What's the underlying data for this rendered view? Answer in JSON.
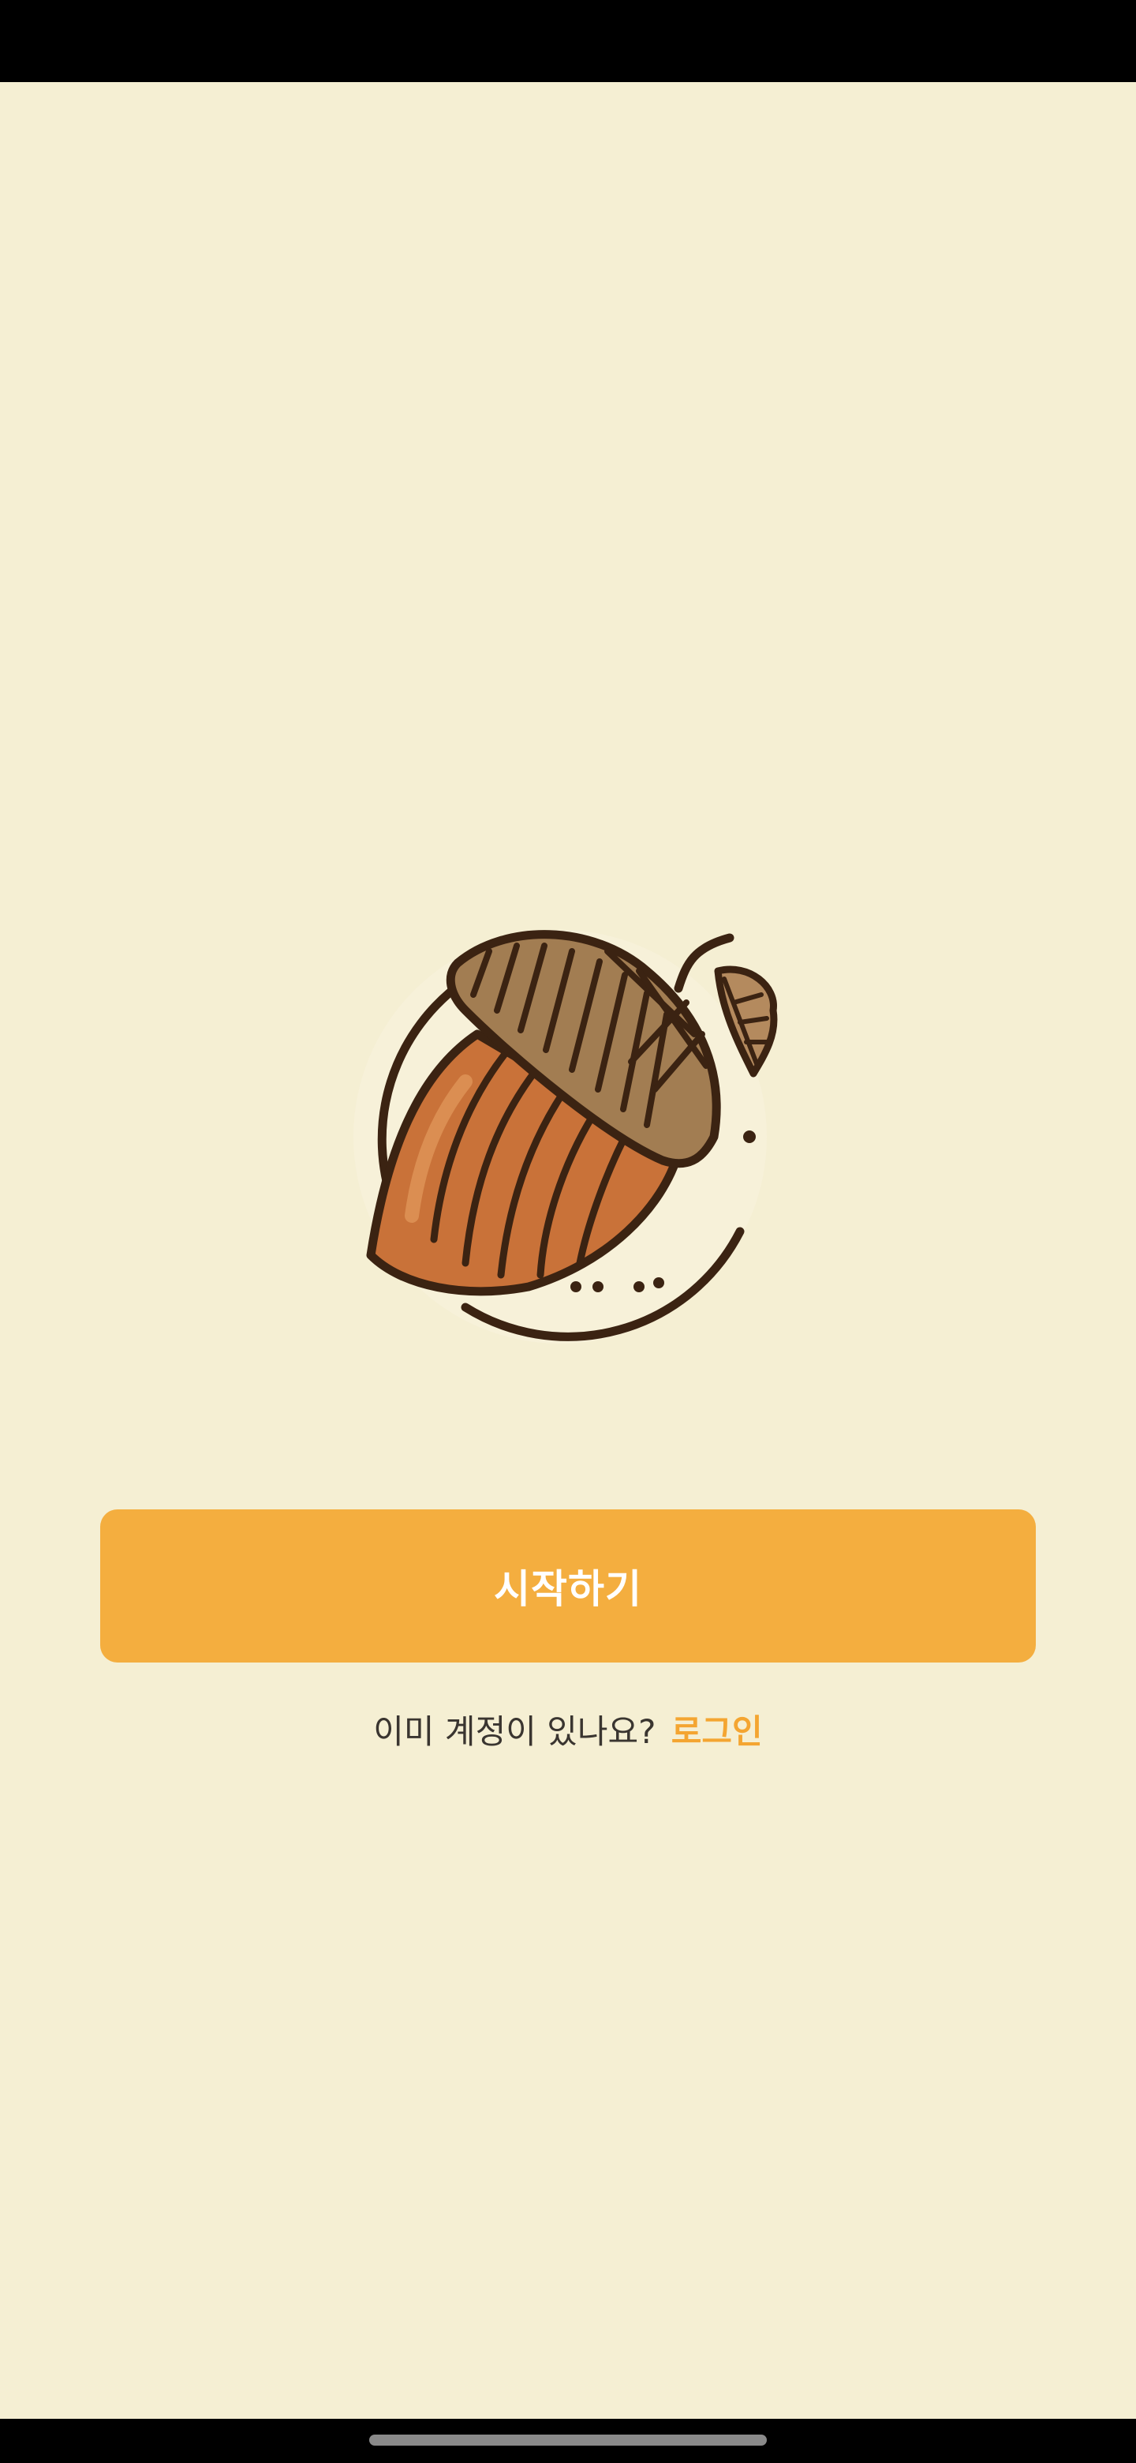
{
  "app": {
    "logo": "acorn-icon"
  },
  "start_button": {
    "label": "시작하기"
  },
  "login_prompt": {
    "text": "이미 계정이 있나요?",
    "link_label": "로그인"
  },
  "colors": {
    "background": "#f5efd3",
    "accent": "#f4ae3f",
    "link": "#f4a531",
    "text": "#3a3530"
  }
}
